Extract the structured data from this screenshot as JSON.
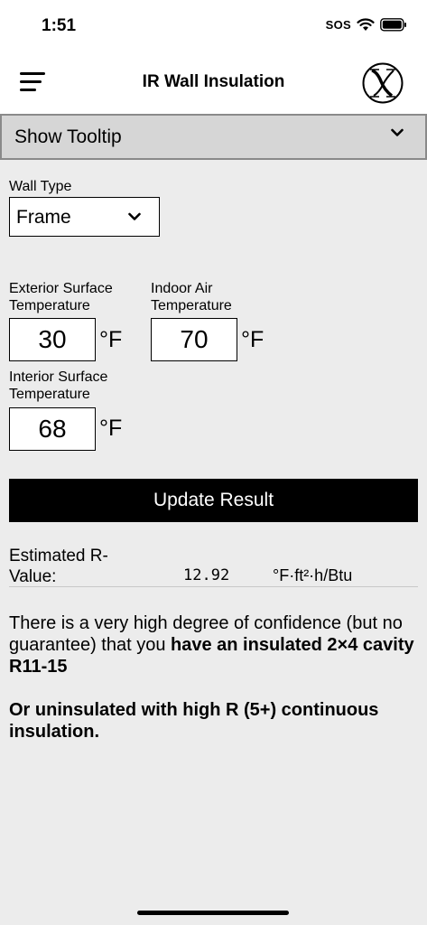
{
  "status_bar": {
    "time": "1:51",
    "sos": "SOS"
  },
  "header": {
    "title": "IR Wall Insulation"
  },
  "tooltip_toggle": {
    "label": "Show Tooltip"
  },
  "wall_type": {
    "label": "Wall Type",
    "value": "Frame"
  },
  "exterior_surface": {
    "label_line1": "Exterior Surface",
    "label_line2": "Temperature",
    "value": "30",
    "unit": "°F"
  },
  "indoor_air": {
    "label_line1": "Indoor Air",
    "label_line2": "Temperature",
    "value": "70",
    "unit": "°F"
  },
  "interior_surface": {
    "label_line1": "Interior Surface",
    "label_line2": "Temperature",
    "value": "68",
    "unit": "°F"
  },
  "update_button": {
    "label": "Update Result"
  },
  "r_value": {
    "label_line1": "Estimated R-",
    "label_line2": "Value:",
    "value": "12.92",
    "unit": "°F·ft²·h/Btu"
  },
  "result": {
    "text_intro": "There is a very high degree of confidence (but no guarantee) that you ",
    "text_bold": "have an insulated 2×4 cavity R11-15",
    "text_alt": "Or uninsulated with high R (5+) continuous insulation."
  }
}
